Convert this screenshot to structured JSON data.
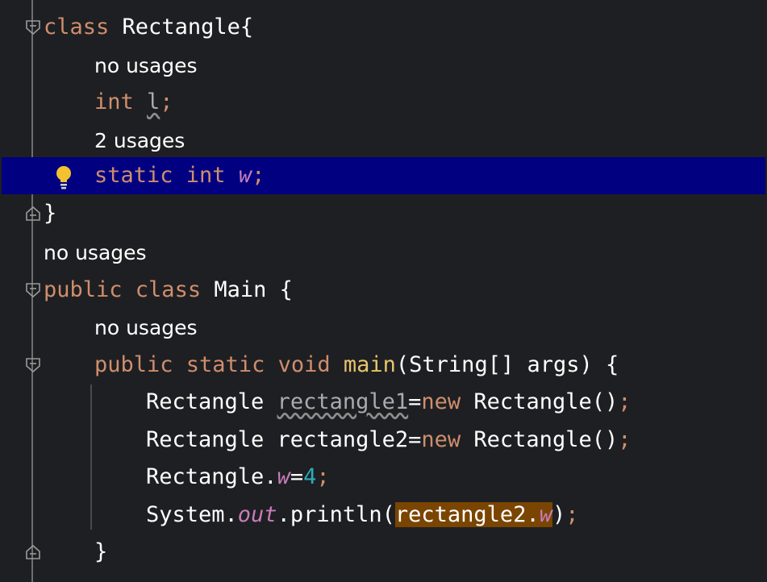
{
  "editor": {
    "lines": [
      {
        "kind": "code",
        "tokens": [
          {
            "t": "class ",
            "c": "kw"
          },
          {
            "t": "Rectangle{",
            "c": "plain"
          }
        ]
      },
      {
        "kind": "hint",
        "text": "no usages"
      },
      {
        "kind": "code",
        "tokens": [
          {
            "t": "int ",
            "c": "kw"
          },
          {
            "t": "l",
            "c": "unused"
          },
          {
            "t": ";",
            "c": "semi"
          }
        ]
      },
      {
        "kind": "hint",
        "text": "2 usages"
      },
      {
        "kind": "code",
        "tokens": [
          {
            "t": "static ",
            "c": "kw"
          },
          {
            "t": "int ",
            "c": "kw"
          },
          {
            "t": "w",
            "c": "field"
          },
          {
            "t": ";",
            "c": "semi"
          }
        ]
      },
      {
        "kind": "code",
        "tokens": [
          {
            "t": "}",
            "c": "plain"
          }
        ]
      },
      {
        "kind": "hint",
        "text": "no usages"
      },
      {
        "kind": "code",
        "tokens": [
          {
            "t": "public ",
            "c": "kw"
          },
          {
            "t": "class ",
            "c": "kw"
          },
          {
            "t": "Main {",
            "c": "plain"
          }
        ]
      },
      {
        "kind": "hint",
        "text": "no usages"
      },
      {
        "kind": "code",
        "tokens": [
          {
            "t": "public ",
            "c": "kw"
          },
          {
            "t": "static ",
            "c": "kw"
          },
          {
            "t": "void ",
            "c": "kw"
          },
          {
            "t": "main",
            "c": "fn"
          },
          {
            "t": "(String[] args) {",
            "c": "plain"
          }
        ]
      },
      {
        "kind": "code",
        "tokens": [
          {
            "t": "Rectangle ",
            "c": "plain"
          },
          {
            "t": "rectangle1",
            "c": "unused"
          },
          {
            "t": "=",
            "c": "plain"
          },
          {
            "t": "new ",
            "c": "kw"
          },
          {
            "t": "Rectangle()",
            "c": "plain"
          },
          {
            "t": ";",
            "c": "semi"
          }
        ]
      },
      {
        "kind": "code",
        "tokens": [
          {
            "t": "Rectangle rectangle2=",
            "c": "plain"
          },
          {
            "t": "new ",
            "c": "kw"
          },
          {
            "t": "Rectangle()",
            "c": "plain"
          },
          {
            "t": ";",
            "c": "semi"
          }
        ]
      },
      {
        "kind": "code",
        "tokens": [
          {
            "t": "Rectangle.",
            "c": "plain"
          },
          {
            "t": "w",
            "c": "field"
          },
          {
            "t": "=",
            "c": "plain"
          },
          {
            "t": "4",
            "c": "num"
          },
          {
            "t": ";",
            "c": "semi"
          }
        ]
      },
      {
        "kind": "code",
        "tokens": [
          {
            "t": "System.",
            "c": "plain"
          },
          {
            "t": "out",
            "c": "field"
          },
          {
            "t": ".println(",
            "c": "plain"
          },
          {
            "t": "rectangle2.",
            "c": "plain highlight"
          },
          {
            "t": "w",
            "c": "field highlight"
          },
          {
            "t": ")",
            "c": "plain"
          },
          {
            "t": ";",
            "c": "semi"
          }
        ]
      },
      {
        "kind": "code",
        "tokens": [
          {
            "t": "}",
            "c": "plain"
          }
        ]
      }
    ]
  },
  "colors": {
    "background": "#1e1f22",
    "current_line": "#000080",
    "keyword": "#cf8e6d",
    "method": "#e8c46b",
    "static_field": "#c77dbb",
    "number": "#2aacb8",
    "text": "#ffffff",
    "search_highlight": "#7a4500"
  },
  "icons": {
    "intention_bulb": "lightbulb-icon",
    "fold_start": "fold-open-icon",
    "fold_end": "fold-close-icon"
  }
}
